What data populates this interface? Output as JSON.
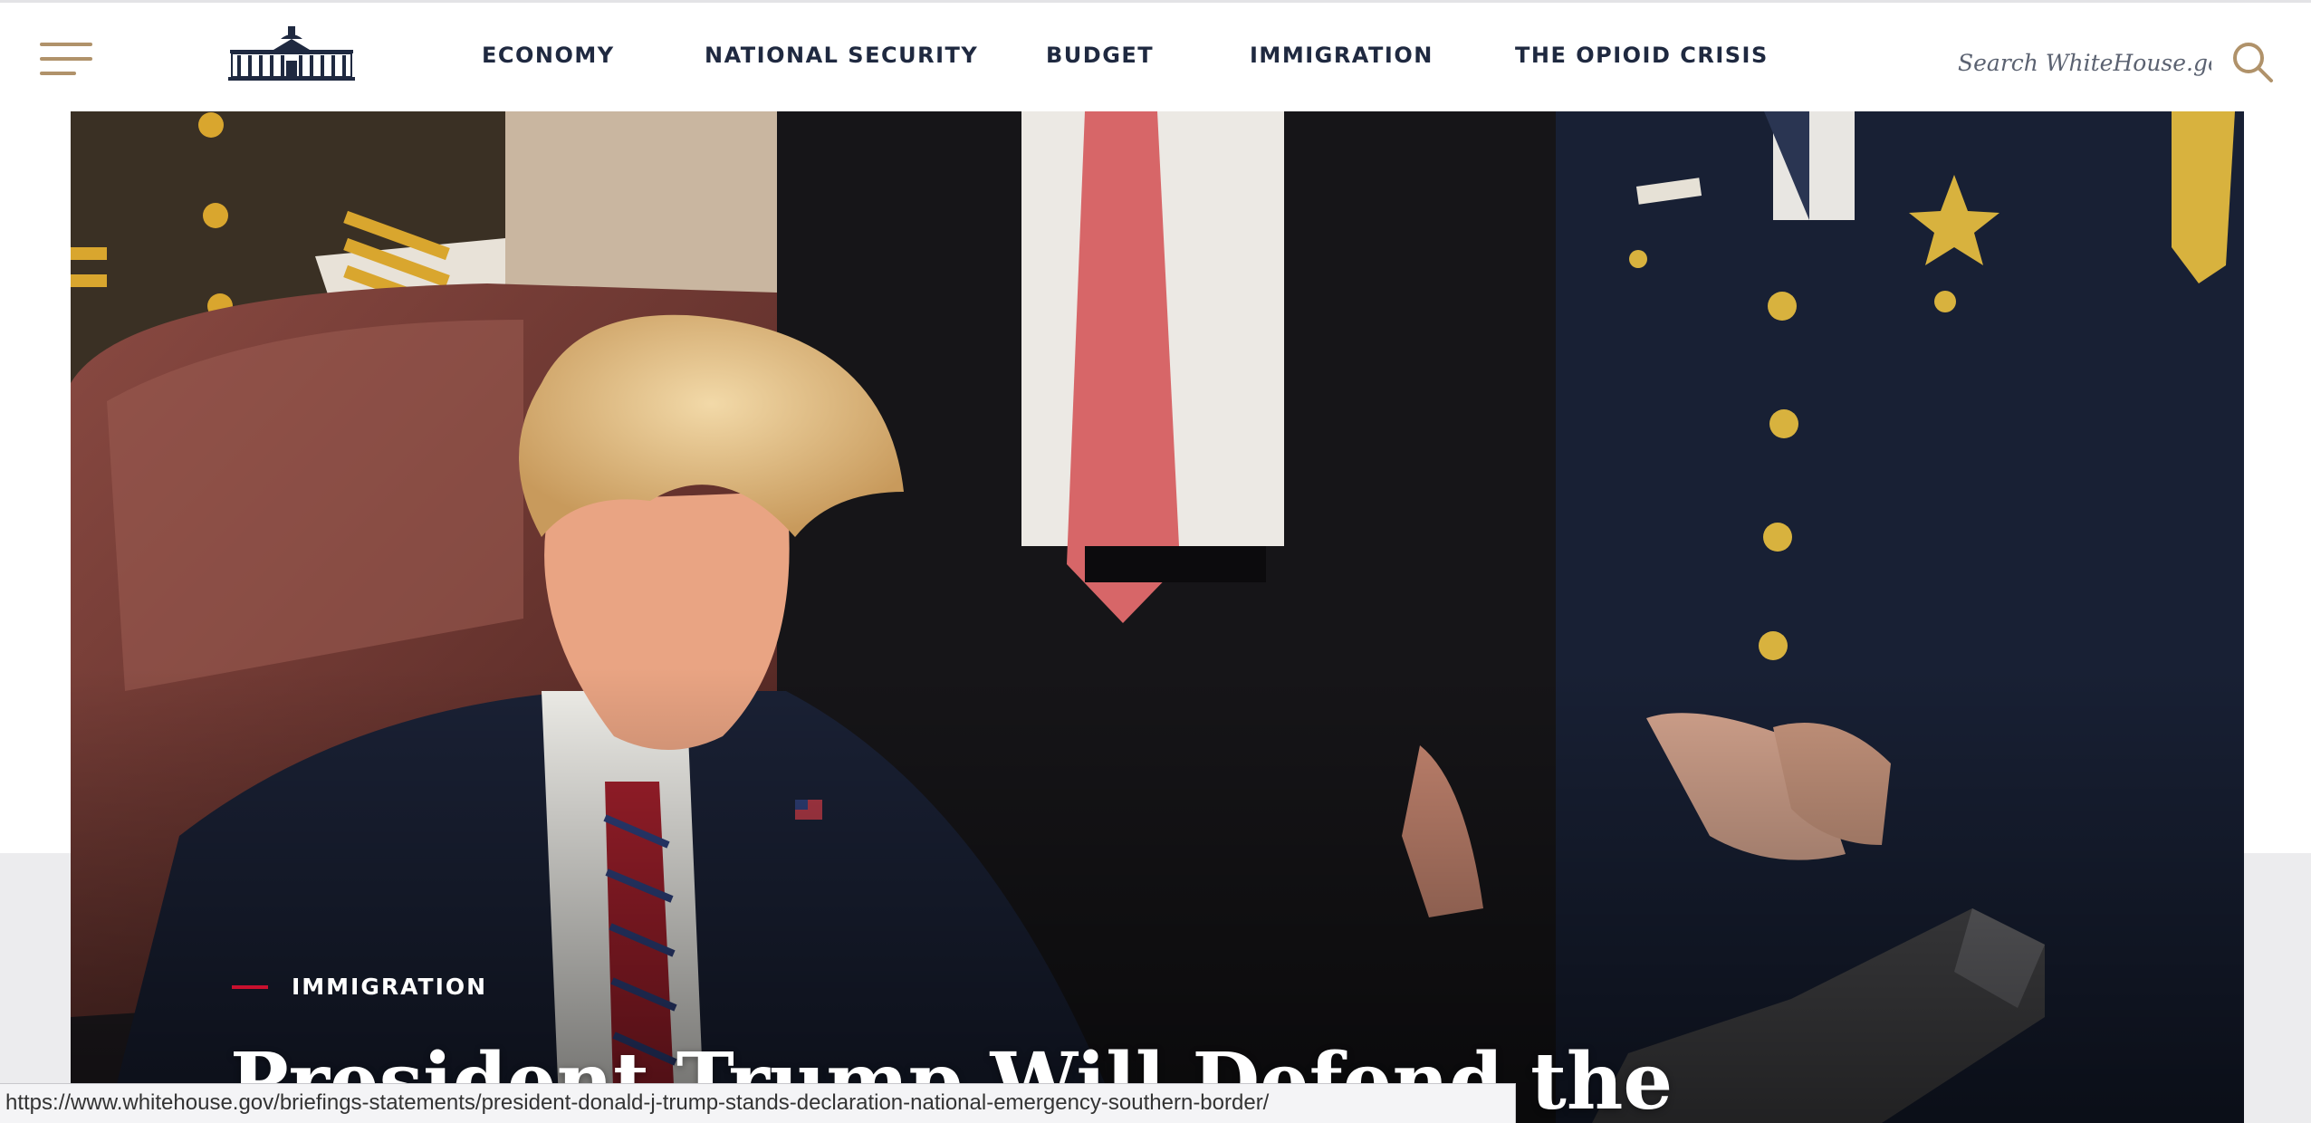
{
  "header": {
    "nav": [
      {
        "label": "ECONOMY"
      },
      {
        "label": "NATIONAL SECURITY"
      },
      {
        "label": "BUDGET"
      },
      {
        "label": "IMMIGRATION"
      },
      {
        "label": "THE OPIOID CRISIS"
      }
    ],
    "search": {
      "placeholder": "Search WhiteHouse.gov"
    },
    "icons": {
      "menu": "hamburger-menu-icon",
      "logo": "white-house-logo",
      "search": "search-icon"
    }
  },
  "hero": {
    "category": "IMMIGRATION",
    "headline": "President Trump Will Defend the"
  },
  "status_bar": {
    "url": "https://www.whitehouse.gov/briefings-statements/president-donald-j-trump-stands-declaration-national-emergency-southern-border/"
  },
  "colors": {
    "accent_gold": "#b0926a",
    "navy": "#1f2940",
    "category_red": "#c8102e",
    "band_gray": "#ececee"
  }
}
